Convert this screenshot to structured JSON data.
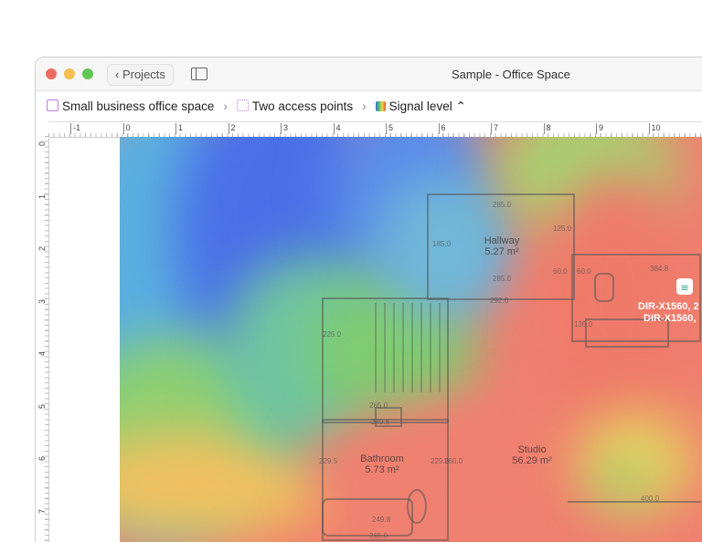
{
  "window": {
    "title": "Sample - Office Space",
    "back_label": "Projects"
  },
  "breadcrumb": [
    {
      "label": "Small business office space"
    },
    {
      "label": "Two access points"
    },
    {
      "label": "Signal level"
    }
  ],
  "ruler": {
    "h": [
      "-1",
      "0",
      "1",
      "2",
      "3",
      "4",
      "5",
      "6",
      "7",
      "8",
      "9",
      "10"
    ],
    "v": [
      "0",
      "1",
      "2",
      "3",
      "4",
      "5",
      "6",
      "7"
    ]
  },
  "rooms": [
    {
      "name": "Hallway",
      "area": "5.27 m²"
    },
    {
      "name": "Bathroom",
      "area": "5.73 m²"
    },
    {
      "name": "Studio",
      "area": "56.29 m²"
    }
  ],
  "dims": [
    "285.0",
    "285.0",
    "185.0",
    "125.0",
    "60.0",
    "60.0",
    "292.6",
    "384.8",
    "135.0",
    "225.0",
    "265.0",
    "249.8",
    "229.5",
    "229.5",
    "260.0",
    "249.8",
    "265.0",
    "400.0"
  ],
  "access_point": {
    "label1": "DIR-X1560, 2",
    "label2": "DIR-X1560,"
  }
}
